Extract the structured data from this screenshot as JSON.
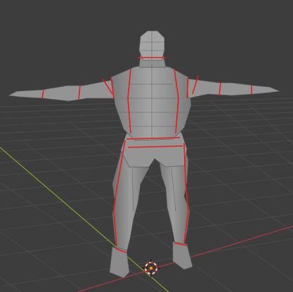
{
  "viewport": {
    "background_color": "#3d3d3d",
    "grid_color": "#4a4a4a",
    "axis_x_color": "#a0383e",
    "axis_y_color": "#7a9a2e",
    "mesh_fill_color": "#8e8e8e",
    "mesh_wire_color": "#5a5a5a",
    "seam_color": "#e0201e",
    "cursor_icon": "3d-cursor-icon",
    "cursor_colors": [
      "#e8e8e8",
      "#e0201e"
    ]
  }
}
